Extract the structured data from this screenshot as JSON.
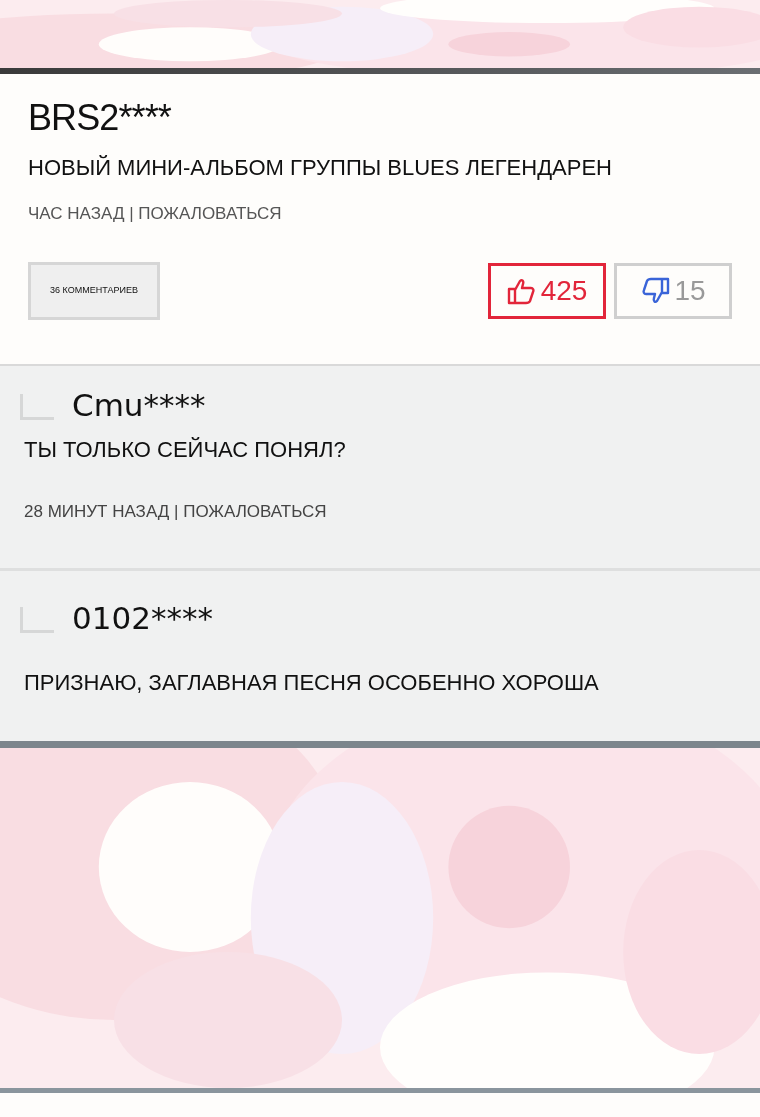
{
  "comment": {
    "author": "BRS2****",
    "text": "НОВЫЙ МИНИ-АЛЬБОМ ГРУППЫ BLUES ЛЕГЕНДАРЕН",
    "meta": "ЧАС НАЗАД | ПОЖАЛОВАТЬСЯ",
    "replies_button": "36 КОММЕНТАРИЕВ",
    "votes": [
      {
        "kind": "like",
        "count": "425",
        "selected": true
      },
      {
        "kind": "dislike",
        "count": "15",
        "selected": false
      }
    ]
  },
  "replies": [
    {
      "author": "Cmu****",
      "text": "ТЫ ТОЛЬКО СЕЙЧАС ПОНЯЛ?",
      "meta": "28 МИНУТ НАЗАД | ПОЖАЛОВАТЬСЯ"
    },
    {
      "author": "0102****",
      "text": "ПРИЗНАЮ, ЗАГЛАВНАЯ ПЕСНЯ ОСОБЕННО ХОРОША"
    }
  ]
}
